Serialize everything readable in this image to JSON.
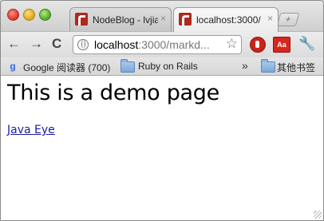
{
  "tabs": [
    {
      "title": "NodeBlog - lvjia",
      "close": "×"
    },
    {
      "title": "localhost:3000/",
      "close": "×"
    }
  ],
  "newtab": "+",
  "toolbar": {
    "back": "←",
    "forward": "→",
    "reload": "C",
    "url_host": "localhost",
    "url_rest": ":3000/markd...",
    "star": "☆",
    "ext_aa": "Aa",
    "wrench": "🔧"
  },
  "bookmarks": {
    "items": [
      {
        "label": "Google 阅读器 (700)"
      },
      {
        "label": "Ruby on Rails"
      }
    ],
    "overflow": "»",
    "other": "其他书签"
  },
  "page": {
    "heading": "This is a demo page",
    "link": "Java Eye"
  }
}
